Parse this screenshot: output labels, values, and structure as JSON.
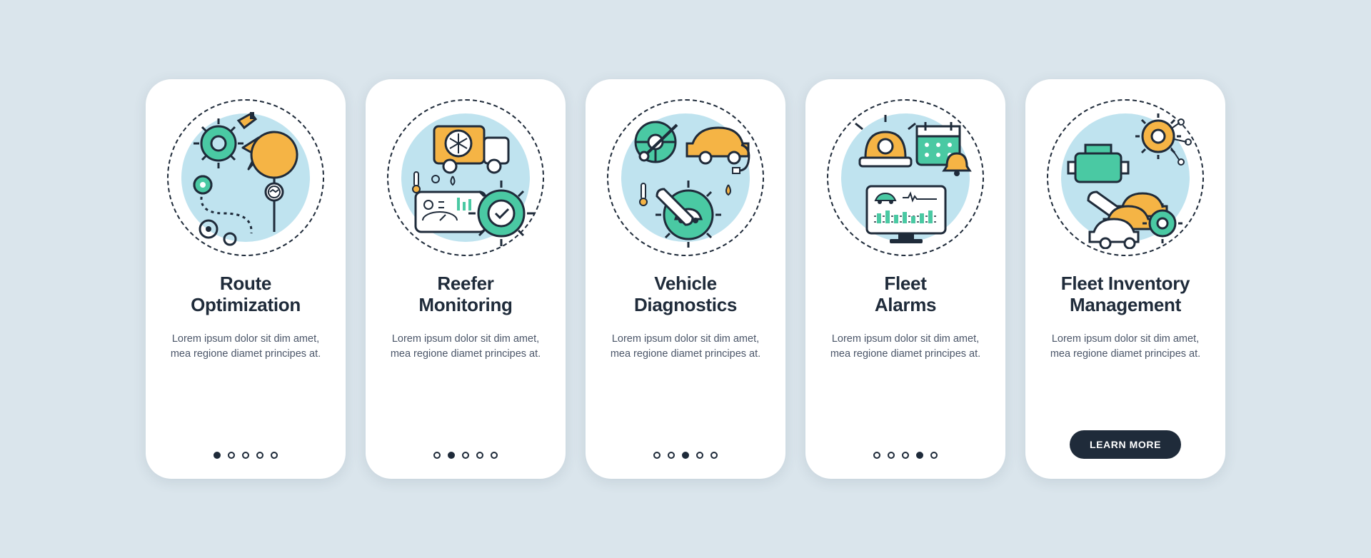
{
  "colors": {
    "teal": "#4ac9a3",
    "orange": "#f5b445",
    "navy": "#1f2b3a",
    "pale_blue": "#bfe3ef",
    "bg": "#dae5ec"
  },
  "cards": [
    {
      "title_line1": "Route",
      "title_line2": "Optimization",
      "description": "Lorem ipsum dolor sit dim amet, mea regione diamet principes at.",
      "active_dot_index": 0,
      "show_button": false,
      "icon": "route-optimization-icon"
    },
    {
      "title_line1": "Reefer",
      "title_line2": "Monitoring",
      "description": "Lorem ipsum dolor sit dim amet, mea regione diamet principes at.",
      "active_dot_index": 1,
      "show_button": false,
      "icon": "reefer-monitoring-icon"
    },
    {
      "title_line1": "Vehicle",
      "title_line2": "Diagnostics",
      "description": "Lorem ipsum dolor sit dim amet, mea regione diamet principes at.",
      "active_dot_index": 2,
      "show_button": false,
      "icon": "vehicle-diagnostics-icon"
    },
    {
      "title_line1": "Fleet",
      "title_line2": "Alarms",
      "description": "Lorem ipsum dolor sit dim amet, mea regione diamet principes at.",
      "active_dot_index": 3,
      "show_button": false,
      "icon": "fleet-alarms-icon"
    },
    {
      "title_line1": "Fleet Inventory",
      "title_line2": "Management",
      "description": "Lorem ipsum dolor sit dim amet, mea regione diamet principes at.",
      "active_dot_index": 4,
      "show_button": true,
      "button_label": "LEARN MORE",
      "icon": "fleet-inventory-icon"
    }
  ],
  "pagination_count": 5
}
